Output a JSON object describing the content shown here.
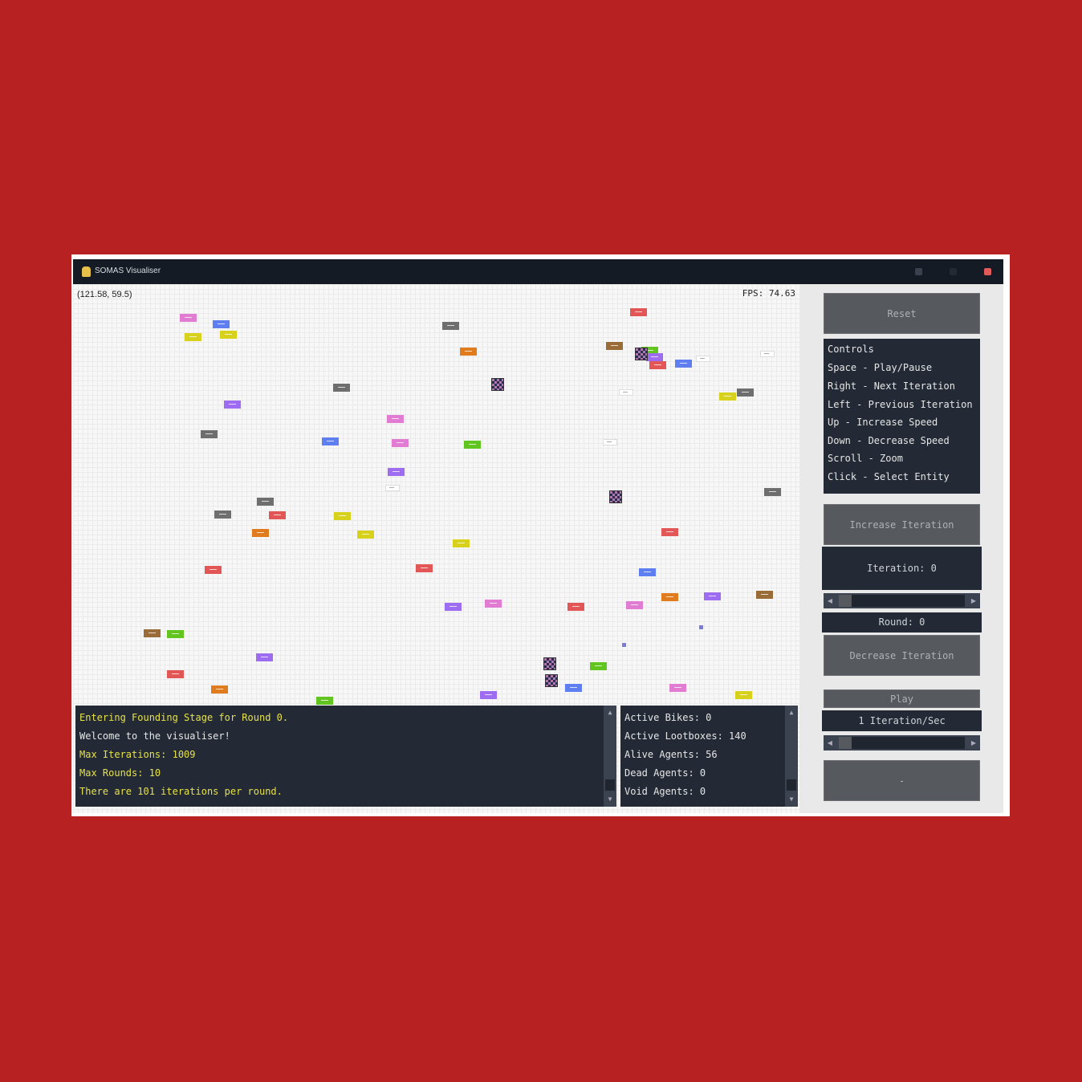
{
  "window": {
    "title": "SOMAS Visualiser"
  },
  "world": {
    "coords": "(121.58, 59.5)",
    "fps": "FPS: 74.63",
    "entity_colors": [
      "#e27bd2",
      "#5f7ff0",
      "#d8d11c",
      "#6e6e6e",
      "#e07b1e",
      "#9a6d38",
      "#e35656",
      "#9d6cf0",
      "#62c51f",
      "#ffffff"
    ]
  },
  "log": {
    "lines": [
      "Entering Founding Stage for Round 0.",
      "Welcome to the visualiser!",
      "Max Iterations: 1009",
      "Max Rounds: 10",
      "There are 101 iterations per round."
    ]
  },
  "stats": {
    "lines": [
      "Active Bikes: 0",
      "Active Lootboxes: 140",
      "Alive Agents: 56",
      "Dead Agents: 0",
      "Void Agents: 0"
    ]
  },
  "panel": {
    "reset_label": "Reset",
    "controls": [
      "Controls",
      "Space - Play/Pause",
      "Right - Next Iteration",
      "Left - Previous Iteration",
      "Up - Increase Speed",
      "Down - Decrease Speed",
      "Scroll - Zoom",
      "Click - Select Entity"
    ],
    "increase_label": "Increase Iteration",
    "iteration_text": "Iteration: 0",
    "round_text": "Round: 0",
    "decrease_label": "Decrease Iteration",
    "play_label": "Play",
    "speed_text": "1 Iteration/Sec",
    "bottom_label": "-"
  }
}
